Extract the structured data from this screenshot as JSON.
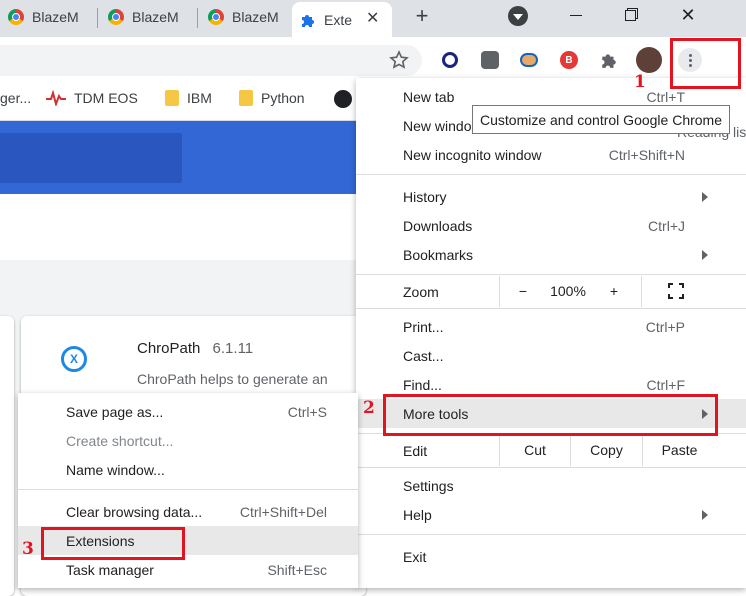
{
  "tabs": [
    {
      "label": "BlazeM"
    },
    {
      "label": "BlazeM"
    },
    {
      "label": "BlazeM"
    },
    {
      "label": "Exte",
      "active": true
    }
  ],
  "bookmarks": [
    {
      "label": "ger...",
      "icon": "person-icon"
    },
    {
      "label": "TDM EOS",
      "icon": "pulse-icon"
    },
    {
      "label": "IBM",
      "icon": "folder-icon"
    },
    {
      "label": "Python",
      "icon": "folder-icon"
    },
    {
      "label": "",
      "icon": "github-icon"
    }
  ],
  "extension_card": {
    "name": "ChroPath",
    "version": "6.1.11",
    "description": "ChroPath helps to generate an"
  },
  "tooltip": "Customize and control Google Chrome",
  "menu": {
    "new_tab": "New tab",
    "new_tab_shortcut": "Ctrl+T",
    "new_window": "New windo",
    "reading_list": "Reading list",
    "new_incognito": "New incognito window",
    "new_incognito_shortcut": "Ctrl+Shift+N",
    "history": "History",
    "downloads": "Downloads",
    "downloads_shortcut": "Ctrl+J",
    "bookmarks": "Bookmarks",
    "zoom": "Zoom",
    "zoom_minus": "−",
    "zoom_level": "100%",
    "zoom_plus": "+",
    "print": "Print...",
    "print_shortcut": "Ctrl+P",
    "cast": "Cast...",
    "find": "Find...",
    "find_shortcut": "Ctrl+F",
    "more_tools": "More tools",
    "edit": "Edit",
    "cut": "Cut",
    "copy": "Copy",
    "paste": "Paste",
    "settings": "Settings",
    "help": "Help",
    "exit": "Exit"
  },
  "submenu": {
    "save_page": "Save page as...",
    "save_page_shortcut": "Ctrl+S",
    "create_shortcut": "Create shortcut...",
    "name_window": "Name window...",
    "clear_browsing": "Clear browsing data...",
    "clear_browsing_shortcut": "Ctrl+Shift+Del",
    "extensions": "Extensions",
    "task_manager": "Task manager",
    "task_manager_shortcut": "Shift+Esc"
  },
  "annotations": {
    "step1": "1",
    "step2": "2",
    "step3": "3",
    "color": "#e3141f"
  }
}
